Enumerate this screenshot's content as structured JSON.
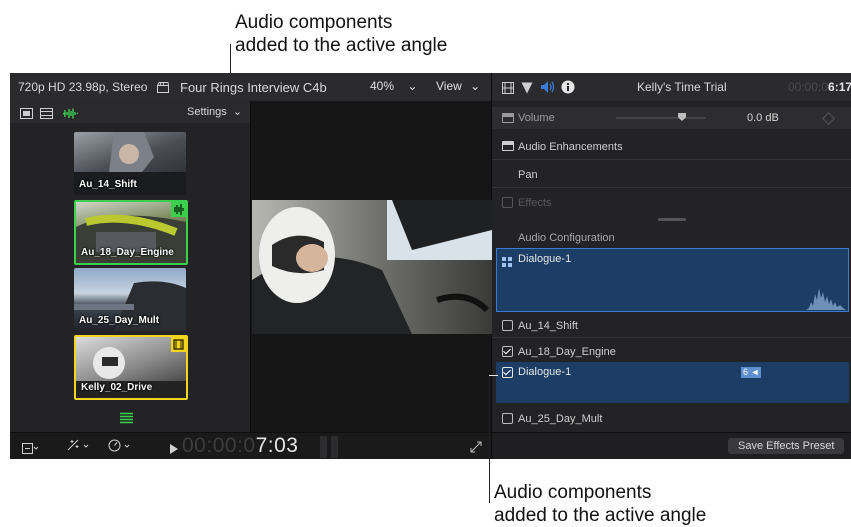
{
  "callouts": {
    "top": [
      "Audio components",
      "added to the active angle"
    ],
    "bottom": [
      "Audio components",
      "added to the active angle"
    ]
  },
  "topbar": {
    "format": "720p HD 23.98p, Stereo",
    "project": "Four Rings Interview C4b",
    "zoom": "40%",
    "view": "View"
  },
  "angle_viewer": {
    "settings": "Settings",
    "angles": [
      {
        "label": "Au_14_Shift",
        "active_audio": false,
        "active_video": false
      },
      {
        "label": "Au_18_Day_Engine",
        "active_audio": true,
        "active_video": false
      },
      {
        "label": "Au_25_Day_Mult",
        "active_audio": false,
        "active_video": false
      },
      {
        "label": "Kelly_02_Drive",
        "active_audio": false,
        "active_video": true
      }
    ]
  },
  "viewer": {
    "timecode_dim": "00:00:0",
    "timecode_bright": "7:03"
  },
  "inspector": {
    "clip_name": "Kelly's Time Trial",
    "duration_dim": "00:00:0",
    "duration_bright": "6:17",
    "volume_label": "Volume",
    "volume_value": "0.0 dB",
    "audio_enhancements": "Audio Enhancements",
    "pan": "Pan",
    "effects": "Effects",
    "audio_configuration": "Audio Configuration",
    "components": [
      {
        "label": "Dialogue-1",
        "type": "group",
        "selected": true
      },
      {
        "label": "Au_14_Shift",
        "type": "angle",
        "checked": false
      },
      {
        "label": "Au_18_Day_Engine",
        "type": "angle",
        "checked": true
      },
      {
        "label": "Dialogue-1",
        "type": "sub",
        "checked": true,
        "channel_badge": "6"
      },
      {
        "label": "Au_25_Day_Mult",
        "type": "angle",
        "checked": false
      }
    ],
    "save_preset": "Save Effects Preset"
  },
  "colors": {
    "accent_blue": "#3a7bd5",
    "audio_green": "#3ccf4e",
    "video_yellow": "#f2d51c",
    "selected_row": "#1c3e66"
  }
}
